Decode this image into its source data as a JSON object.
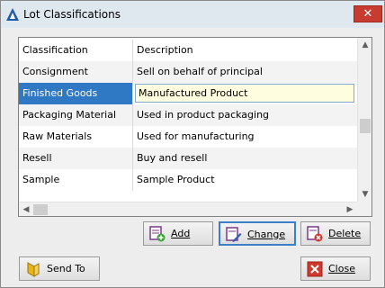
{
  "window": {
    "title": "Lot Classifications",
    "close_glyph": "✕"
  },
  "grid": {
    "headers": [
      "Classification",
      "Description"
    ],
    "rows": [
      {
        "classification": "Consignment",
        "description": "Sell on behalf of principal"
      },
      {
        "classification": "Finished Goods",
        "description": "Manufactured Product"
      },
      {
        "classification": "Packaging Material",
        "description": "Used in product packaging"
      },
      {
        "classification": "Raw Materials",
        "description": "Used for manufacturing"
      },
      {
        "classification": "Resell",
        "description": "Buy and resell"
      },
      {
        "classification": "Sample",
        "description": "Sample Product"
      }
    ],
    "selected_row": 1
  },
  "buttons": {
    "add": "Add",
    "change": "Change",
    "delete": "Delete",
    "send_to": "Send To",
    "close": "Close"
  },
  "icons": {
    "app": "app-triangle-icon",
    "add": "add-record-icon",
    "change": "edit-record-icon",
    "delete": "delete-record-icon",
    "send_to": "send-to-icon",
    "close": "close-red-icon"
  },
  "colors": {
    "selection": "#2f78c4",
    "close_red": "#c83b30",
    "edit_bg": "#fffde0"
  }
}
